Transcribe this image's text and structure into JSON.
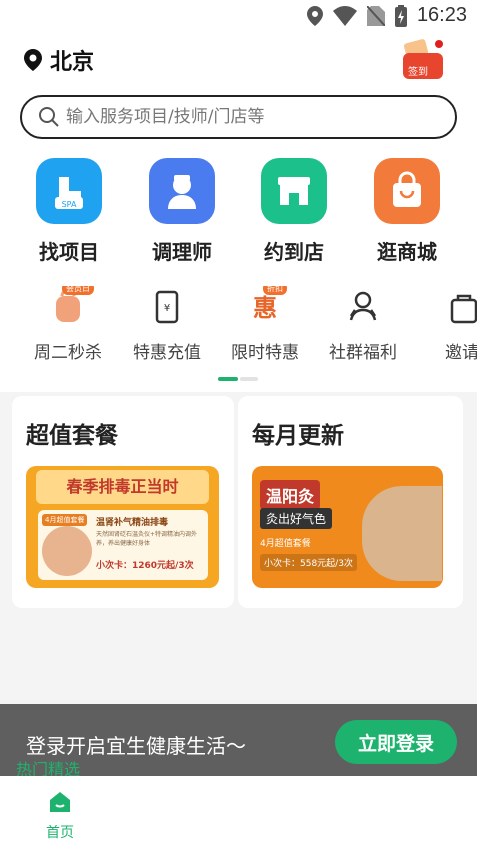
{
  "status_bar": {
    "time": "16:23"
  },
  "header": {
    "city": "北京",
    "signin_label": "签到"
  },
  "search": {
    "placeholder": "输入服务项目/技师/门店等"
  },
  "categories": [
    {
      "label": "找项目",
      "icon": "spa-icon",
      "color": "#1fa3f0"
    },
    {
      "label": "调理师",
      "icon": "therapist-icon",
      "color": "#4a7cf0"
    },
    {
      "label": "约到店",
      "icon": "store-icon",
      "color": "#1cc08a"
    },
    {
      "label": "逛商城",
      "icon": "shopping-bag-icon",
      "color": "#f27a3a"
    }
  ],
  "promos": [
    {
      "label": "周二秒杀",
      "icon": "flash-sale-icon",
      "badge": "会员日"
    },
    {
      "label": "特惠充值",
      "icon": "recharge-icon"
    },
    {
      "label": "限时特惠",
      "icon": "discount-icon",
      "badge": "折扣",
      "icon_text": "惠"
    },
    {
      "label": "社群福利",
      "icon": "community-icon"
    },
    {
      "label": "邀请",
      "icon": "invite-icon"
    }
  ],
  "cards": [
    {
      "title": "超值套餐",
      "banner": {
        "headline": "春季排毒正当时",
        "tag": "4月超值套餐",
        "name": "温肾补气精油排毒",
        "desc": "天然固肾砭石温灸仪+特调精油内调外养，养出健康好身体",
        "price": "小次卡：1260元起/3次"
      }
    },
    {
      "title": "每月更新",
      "banner": {
        "headline": "温阳灸",
        "sub": "灸出好气色",
        "package": "4月超值套餐",
        "price": "小次卡：558元起/3次"
      }
    }
  ],
  "login_bar": {
    "text": "登录开启宜生健康生活～",
    "button": "立即登录",
    "hot_label": "热门精选"
  },
  "tabbar": {
    "home_label": "首页"
  },
  "colors": {
    "accent": "#1db36e",
    "login_bg": "#5f5f5f"
  }
}
